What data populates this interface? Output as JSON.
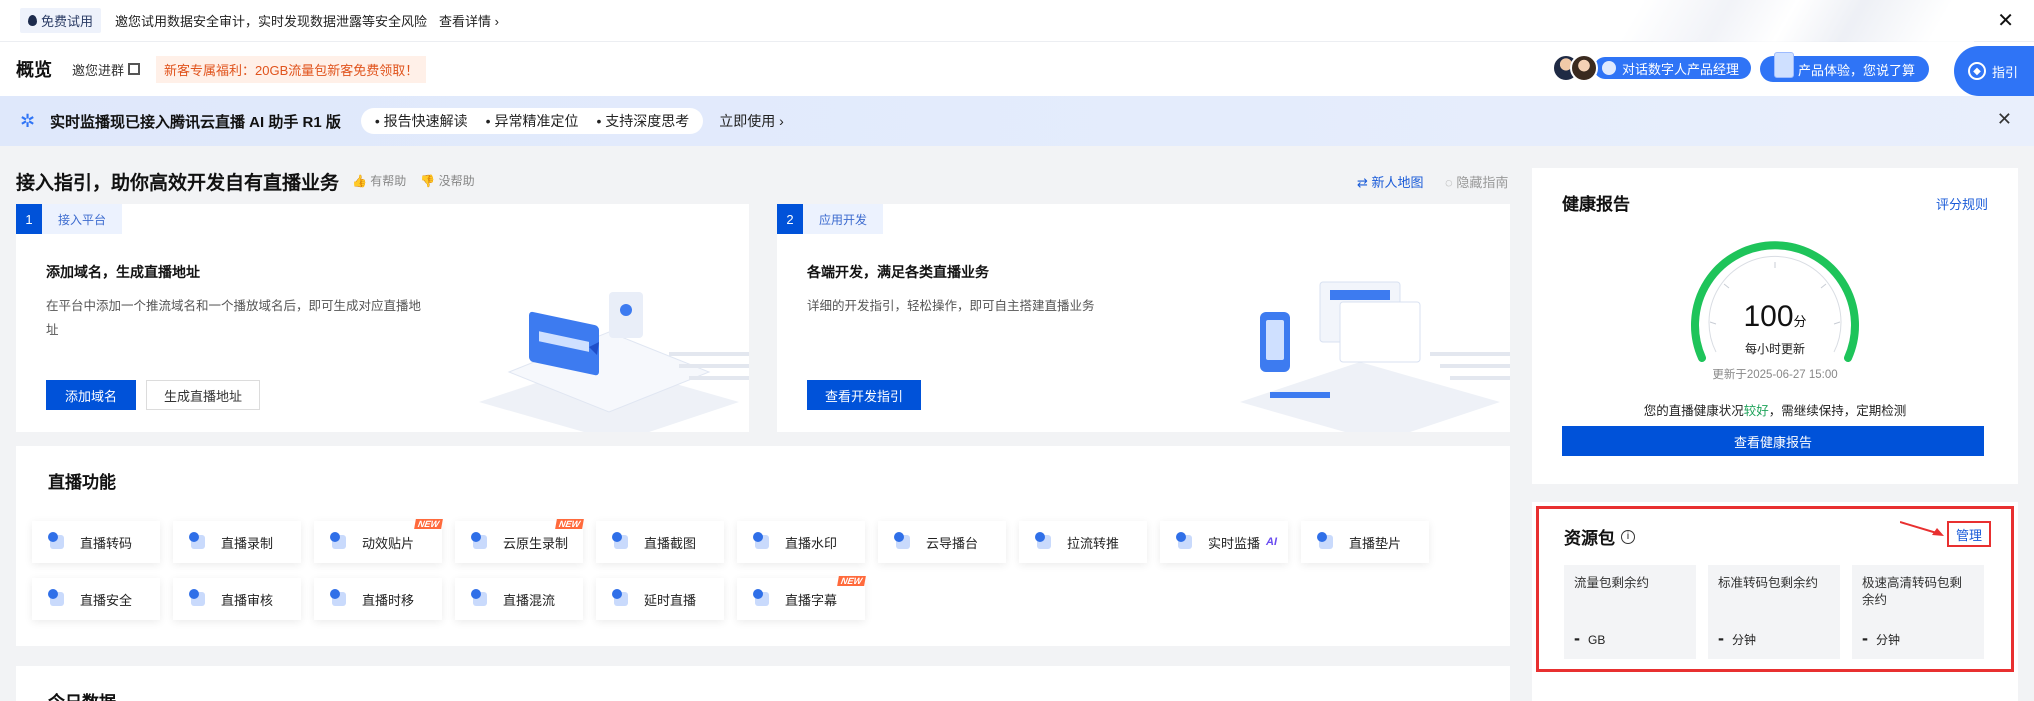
{
  "notice": {
    "badge": "免费试用",
    "message": "邀您试用数据安全审计，实时发现数据泄露等安全风险",
    "more": "查看详情",
    "close": "✕"
  },
  "header": {
    "title": "概览",
    "group": "邀您进群",
    "promo": "新客专属福利：20GB流量包新客免费领取！",
    "ai_manager": "对话数字人产品经理",
    "experience": "产品体验，您说了算",
    "guide": "指引"
  },
  "ai_banner": {
    "text": "实时监播现已接入腾讯云直播 AI 助手 R1 版",
    "chips": [
      "• 报告快速解读",
      "• 异常精准定位",
      "• 支持深度思考"
    ],
    "use": "立即使用 ›",
    "close": "✕"
  },
  "guide_section": {
    "title": "接入指引，助你高效开发自有直播业务",
    "helpful": "有帮助",
    "not_helpful": "没帮助",
    "new_map": "新人地图",
    "hide_guide": "隐藏指南",
    "steps": [
      {
        "num": "1",
        "tag": "接入平台",
        "heading": "添加域名，生成直播地址",
        "desc": "在平台中添加一个推流域名和一个播放域名后，即可生成对应直播地址",
        "primary": "添加域名",
        "secondary": "生成直播地址"
      },
      {
        "num": "2",
        "tag": "应用开发",
        "heading": "各端开发，满足各类直播业务",
        "desc": "详细的开发指引，轻松操作，即可自主搭建直播业务",
        "primary": "查看开发指引"
      }
    ]
  },
  "features": {
    "title": "直播功能",
    "items": [
      {
        "label": "直播转码"
      },
      {
        "label": "直播录制"
      },
      {
        "label": "动效贴片",
        "badge": "NEW"
      },
      {
        "label": "云原生录制",
        "badge": "NEW"
      },
      {
        "label": "直播截图"
      },
      {
        "label": "直播水印"
      },
      {
        "label": "云导播台"
      },
      {
        "label": "拉流转推"
      },
      {
        "label": "实时监播",
        "ai": "AI"
      },
      {
        "label": "直播垫片"
      },
      {
        "label": "直播安全"
      },
      {
        "label": "直播审核"
      },
      {
        "label": "直播时移"
      },
      {
        "label": "直播混流"
      },
      {
        "label": "延时直播"
      },
      {
        "label": "直播字幕",
        "badge": "NEW"
      }
    ]
  },
  "today": {
    "title": "今日数据"
  },
  "health": {
    "title": "健康报告",
    "rule": "评分规则",
    "score": "100",
    "score_unit": "分",
    "hourly": "每小时更新",
    "updated": "更新于2025-06-27 15:00",
    "status_prefix": "您的直播健康状况",
    "status_good": "较好",
    "status_suffix": "，需继续保持，定期检测",
    "view": "查看健康报告",
    "score_fraction": 1.0
  },
  "resources": {
    "title": "资源包",
    "info": "i",
    "manage": "管理",
    "tiles": [
      {
        "label": "流量包剩余约",
        "value": "-",
        "unit": "GB"
      },
      {
        "label": "标准转码包剩余约",
        "value": "-",
        "unit": "分钟"
      },
      {
        "label": "极速高清转码包剩余约",
        "value": "-",
        "unit": "分钟"
      }
    ]
  },
  "colors": {
    "primary": "#0052d9",
    "accent": "#2f74f6",
    "gauge": "#1ec45a",
    "highlight": "#e83030"
  }
}
